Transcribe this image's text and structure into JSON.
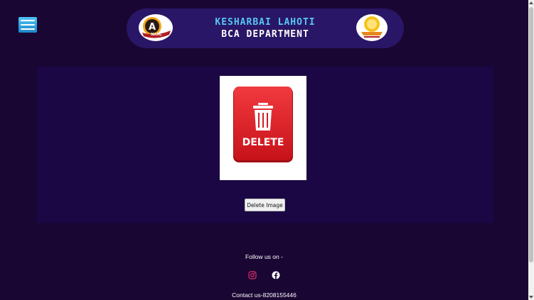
{
  "header": {
    "title_line1": "KESHARBAI LAHOTI",
    "title_line2": "BCA DEPARTMENT",
    "naac_logo_text": "NAAC",
    "naac_grade": "A"
  },
  "menu": {
    "icon": "hamburger-menu-icon"
  },
  "content": {
    "image_text": "DELETE",
    "image_icon": "trash-can-icon",
    "delete_button_label": "Delete Image"
  },
  "footer": {
    "follow_text": "Follow us on -",
    "social": [
      "instagram-icon",
      "facebook-icon"
    ],
    "contact_text": "Contact us-8208155446"
  },
  "colors": {
    "background": "#1a0633",
    "header_bg": "#2a1666",
    "panel_bg": "#1b0744",
    "title_accent": "#56c7f5",
    "delete_red": "#e31e24",
    "instagram": "#e1306c"
  }
}
